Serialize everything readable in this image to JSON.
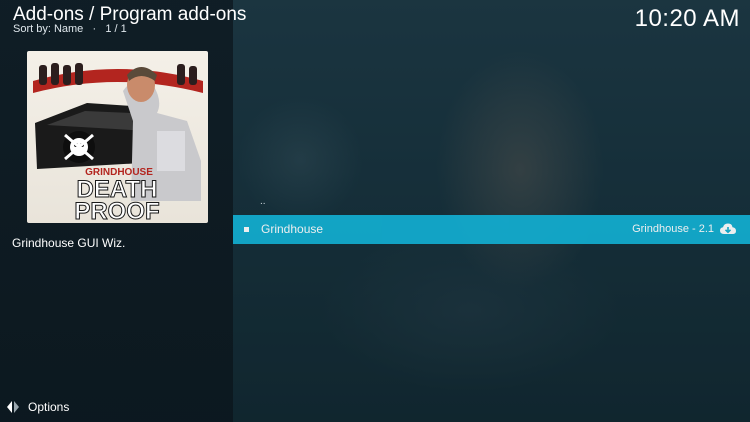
{
  "header": {
    "title": "Add-ons / Program add-ons",
    "sort": "Sort by: Name",
    "sep": "·",
    "page": "1 / 1"
  },
  "clock": "10:20 AM",
  "poster": {
    "top_text": "GRINDHOUSE",
    "title_line1": "DEATH",
    "title_line2": "PROOF"
  },
  "description": "Grindhouse GUI Wiz.",
  "list": {
    "parent": "..",
    "items": [
      {
        "label": "Grindhouse",
        "version": "Grindhouse - 2.1"
      }
    ]
  },
  "footer": {
    "options_label": "Options"
  },
  "colors": {
    "highlight": "#12aed1",
    "panel": "#0e1b23",
    "text": "#ffffff"
  }
}
